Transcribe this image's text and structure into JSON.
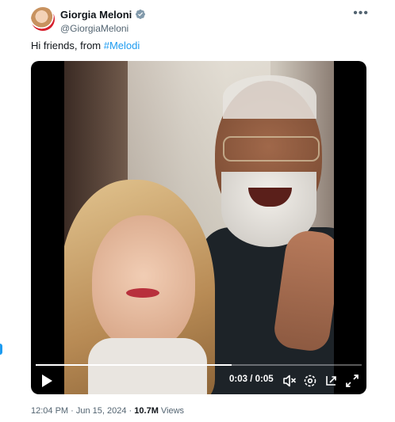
{
  "author": {
    "display_name": "Giorgia Meloni",
    "handle": "@GiorgiaMeloni",
    "verified_icon": "verified-badge-icon"
  },
  "tweet": {
    "text_prefix": "Hi friends, from ",
    "hashtag": "#Melodi"
  },
  "video": {
    "current_time": "0:03",
    "separator": " / ",
    "duration": "0:05",
    "progress": 0.6,
    "controls": [
      "play-icon",
      "mute-icon",
      "settings-icon",
      "pip-icon",
      "fullscreen-icon"
    ]
  },
  "meta": {
    "time": "12:04 PM",
    "dot": " · ",
    "date": "Jun 15, 2024",
    "views_count": "10.7M",
    "views_label": " Views"
  },
  "colors": {
    "accent": "#1d9bf0",
    "secondary_text": "#536471",
    "primary_text": "#0f1419"
  }
}
